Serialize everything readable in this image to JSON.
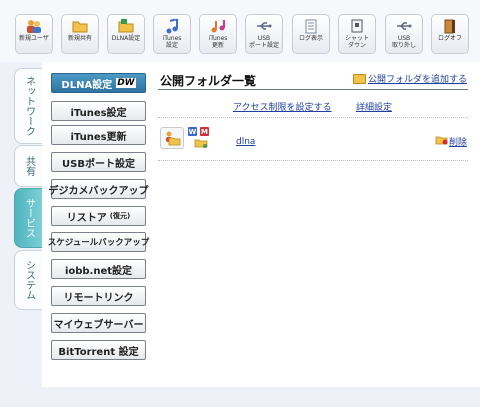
{
  "toolbar": {
    "buttons": [
      {
        "label": "新規ユーザ",
        "icon": "users-icon"
      },
      {
        "label": "新規共有",
        "icon": "folder-icon"
      },
      {
        "label": "DLNA設定",
        "icon": "dlna-folder-icon"
      },
      {
        "label": "iTunes\n設定",
        "icon": "music-note-icon"
      },
      {
        "label": "iTunes\n更新",
        "icon": "music-notes-icon"
      },
      {
        "label": "USB\nポート設定",
        "icon": "usb-icon"
      },
      {
        "label": "ログ表示",
        "icon": "log-icon"
      },
      {
        "label": "シャット\nダウン",
        "icon": "shutdown-icon"
      },
      {
        "label": "USB\n取り外し",
        "icon": "usb-remove-icon"
      },
      {
        "label": "ログオフ",
        "icon": "logoff-door-icon"
      }
    ]
  },
  "tabs": [
    {
      "label": "ネットワーク",
      "active": false
    },
    {
      "label": "共有",
      "active": false
    },
    {
      "label": "サービス",
      "active": true
    },
    {
      "label": "システム",
      "active": false
    }
  ],
  "sidebar": {
    "items": [
      {
        "label": "DLNA設定",
        "badge": "DW",
        "active": true
      },
      {
        "label": "iTunes設定"
      },
      {
        "label": "iTunes更新"
      },
      {
        "label": "USBポート設定"
      },
      {
        "label": "デジカメバックアップ"
      },
      {
        "label": "リストア",
        "small": "(復元)"
      },
      {
        "label": "スケジュールバックアップ"
      },
      {
        "label": "iobb.net設定"
      },
      {
        "label": "リモートリンク"
      },
      {
        "label": "マイウェブサーバー"
      },
      {
        "label": "BitTorrent 設定"
      }
    ]
  },
  "content": {
    "title": "公開フォルダ一覧",
    "add_folder_link": "公開フォルダを追加する",
    "access_link": "アクセス制限を設定する",
    "detail_link": "詳細設定",
    "folder": {
      "name": "dlna",
      "badge_w": "W",
      "badge_m": "M",
      "delete_label": "削除"
    }
  },
  "colors": {
    "accent": "#2f73a0",
    "tab_active": "#4fb4bd",
    "link": "#2040a0"
  }
}
